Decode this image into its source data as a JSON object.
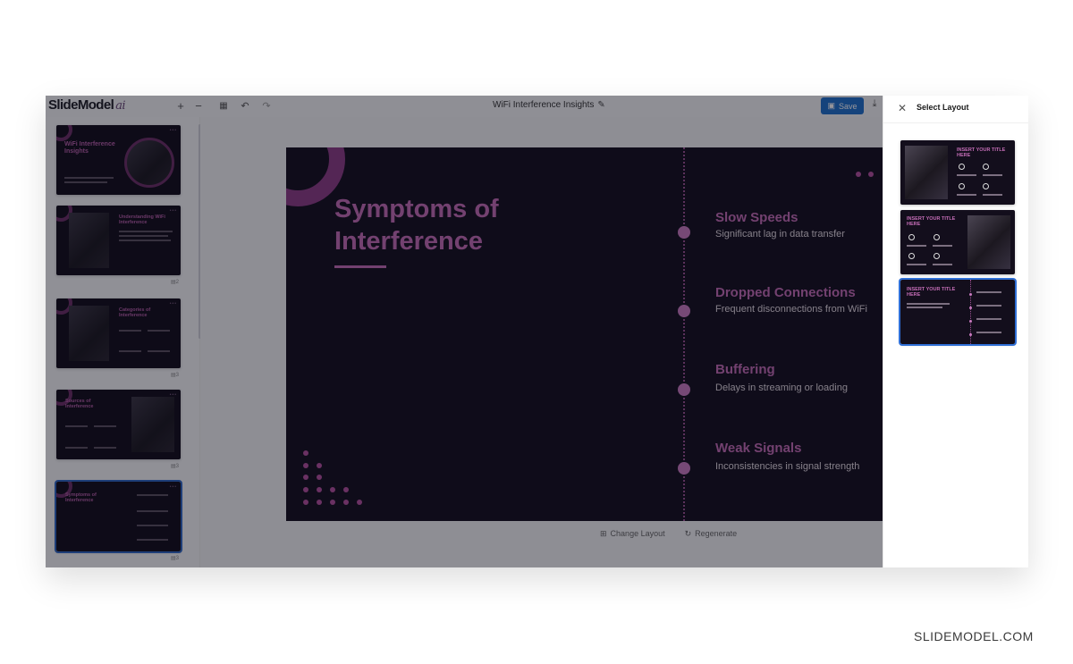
{
  "app": {
    "logo_text": "SlideModel",
    "logo_suffix": "ai",
    "doc_title": "WiFi Interference Insights",
    "save_label": "Save"
  },
  "toolbar_icons": [
    "plus-icon",
    "minus-icon",
    "grid-icon",
    "undo-icon",
    "redo-icon",
    "pencil-icon",
    "save-icon",
    "download-icon"
  ],
  "thumbnails": [
    {
      "title": "WiFi Interference Insights",
      "number": ""
    },
    {
      "title": "Understanding WiFi Interference",
      "number": "2"
    },
    {
      "title": "Categories of Interference",
      "number": "3"
    },
    {
      "title": "Sources of Interference",
      "number": "3"
    },
    {
      "title": "Symptoms of Interference",
      "number": "3"
    }
  ],
  "slide": {
    "title": "Symptoms of Interference",
    "items": [
      {
        "title": "Slow Speeds",
        "desc": "Significant lag in data transfer"
      },
      {
        "title": "Dropped Connections",
        "desc": "Frequent disconnections from WiFi"
      },
      {
        "title": "Buffering",
        "desc": "Delays in streaming or loading"
      },
      {
        "title": "Weak Signals",
        "desc": "Inconsistencies in signal strength"
      }
    ]
  },
  "canvas_actions": {
    "change_layout": "Change Layout",
    "regenerate": "Regenerate"
  },
  "panel": {
    "title": "Select Layout",
    "layouts": [
      {
        "title": "INSERT YOUR TITLE HERE"
      },
      {
        "title": "INSERT YOUR TITLE HERE"
      },
      {
        "title": "INSERT YOUR TITLE HERE"
      }
    ]
  },
  "watermark": "SLIDEMODEL.COM",
  "colors": {
    "slide_bg": "#140f1f",
    "accent": "#c36cb5",
    "save_button": "#1f6fcb",
    "selection": "#2f6fd6"
  }
}
